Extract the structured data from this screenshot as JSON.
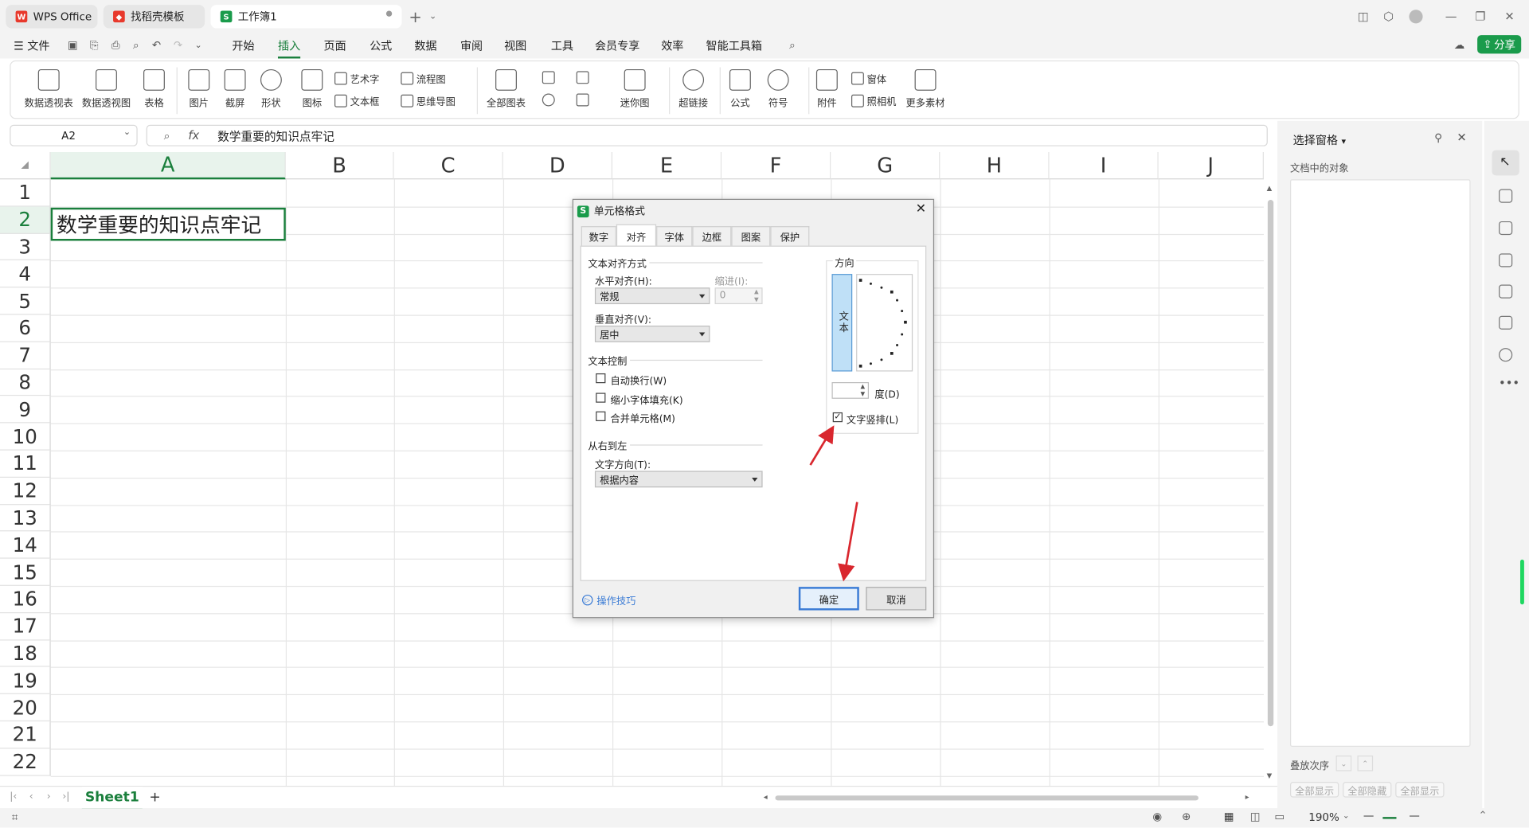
{
  "titlebar": {
    "tabs": [
      {
        "label": "WPS Office",
        "icon": "wps-logo-icon"
      },
      {
        "label": "找稻壳模板",
        "icon": "docer-icon"
      },
      {
        "label": "工作簿1",
        "icon": "spreadsheet-icon"
      }
    ]
  },
  "menubar": {
    "file": "文件",
    "items": [
      "开始",
      "插入",
      "页面",
      "公式",
      "数据",
      "审阅",
      "视图",
      "工具",
      "会员专享",
      "效率",
      "智能工具箱"
    ],
    "active": "插入",
    "share": "分享",
    "accent": "#1a7f3c"
  },
  "ribbon": {
    "big": [
      "数据透视表",
      "数据透视图",
      "表格"
    ],
    "pics": [
      "图片",
      "截屏",
      "形状",
      "图标"
    ],
    "art": [
      "艺术字",
      "文本框"
    ],
    "flow": [
      "流程图",
      "思维导图"
    ],
    "chart": "全部图表",
    "mini": "迷你图",
    "link": "超链接",
    "formula": "公式",
    "symbol": "符号",
    "attach": "附件",
    "window": "窗体",
    "camera": "照相机",
    "more": "更多素材"
  },
  "formula": {
    "cell_ref": "A2",
    "fx": "fx",
    "content": "数学重要的知识点牢记"
  },
  "grid": {
    "columns": [
      "A",
      "B",
      "C",
      "D",
      "E",
      "F",
      "G",
      "H",
      "I",
      "J"
    ],
    "rows": [
      "1",
      "2",
      "3",
      "4",
      "5",
      "6",
      "7",
      "8",
      "9",
      "10",
      "11",
      "12",
      "13",
      "14",
      "15",
      "16",
      "17",
      "18",
      "19",
      "20",
      "21",
      "22"
    ],
    "a2": "数学重要的知识点牢记"
  },
  "sheets": {
    "active": "Sheet1",
    "add": "+"
  },
  "status": {
    "zoom": "190%"
  },
  "pane": {
    "title": "选择窗格",
    "subtitle": "文档中的对象",
    "order": "叠放次序",
    "show_all": "全部显示",
    "hide_all": "全部隐藏",
    "show_all2": "全部显示"
  },
  "dialog": {
    "title": "单元格格式",
    "tabs": [
      "数字",
      "对齐",
      "字体",
      "边框",
      "图案",
      "保护"
    ],
    "active_tab": "对齐",
    "text_align": "文本对齐方式",
    "h_align_label": "水平对齐(H):",
    "h_align_value": "常规",
    "indent_label": "缩进(I):",
    "indent_value": "0",
    "v_align_label": "垂直对齐(V):",
    "v_align_value": "居中",
    "text_control": "文本控制",
    "wrap": "自动换行(W)",
    "shrink": "缩小字体填充(K)",
    "merge": "合并单元格(M)",
    "rtl": "从右到左",
    "text_dir_label": "文字方向(T):",
    "text_dir_value": "根据内容",
    "orientation": "方向",
    "orient_text": "文本",
    "degree_label": "度(D)",
    "vertical_text": "文字竖排(L)",
    "vertical_text_checked": true,
    "tips": "操作技巧",
    "ok": "确定",
    "cancel": "取消"
  }
}
